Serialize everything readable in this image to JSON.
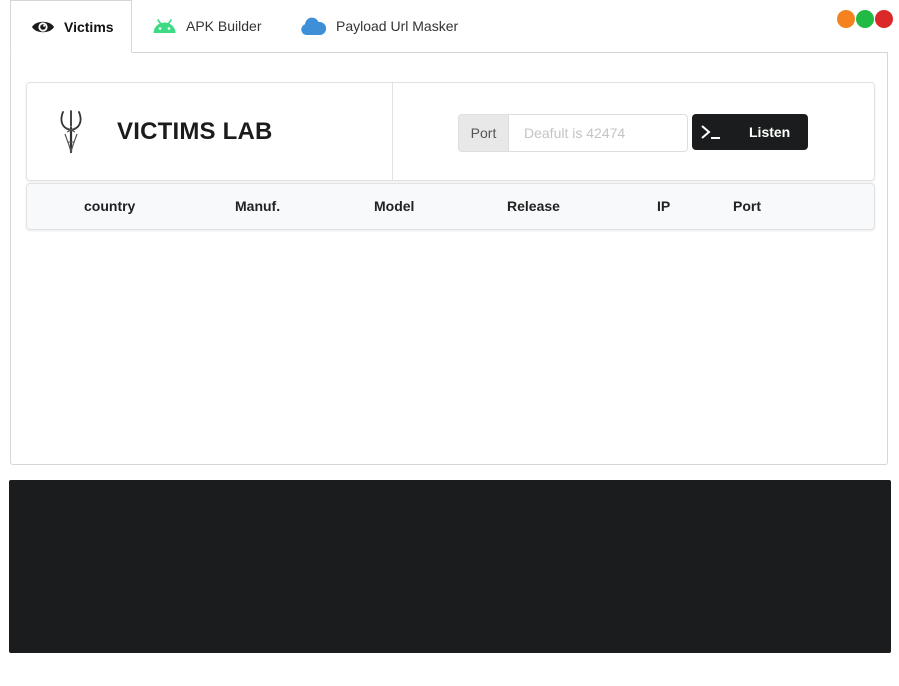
{
  "tabs": [
    {
      "label": "Victims",
      "icon": "eye-icon"
    },
    {
      "label": "APK Builder",
      "icon": "android-icon"
    },
    {
      "label": "Payload Url Masker",
      "icon": "cloud-icon"
    }
  ],
  "window_controls": {
    "minimize_color": "#f5821f",
    "maximize_color": "#21ba45",
    "close_color": "#db2828"
  },
  "lab": {
    "title": "VICTIMS LAB",
    "logo": "trident-logo"
  },
  "listener": {
    "port_label": "Port",
    "port_placeholder": "Deafult is 42474",
    "port_value": "",
    "listen_label": "Listen",
    "listen_icon": "terminal-icon"
  },
  "table": {
    "columns": [
      "country",
      "Manuf.",
      "Model",
      "Release",
      "IP",
      "Port"
    ],
    "rows": []
  },
  "console": {
    "lines": [],
    "background": "#1b1c1d"
  }
}
